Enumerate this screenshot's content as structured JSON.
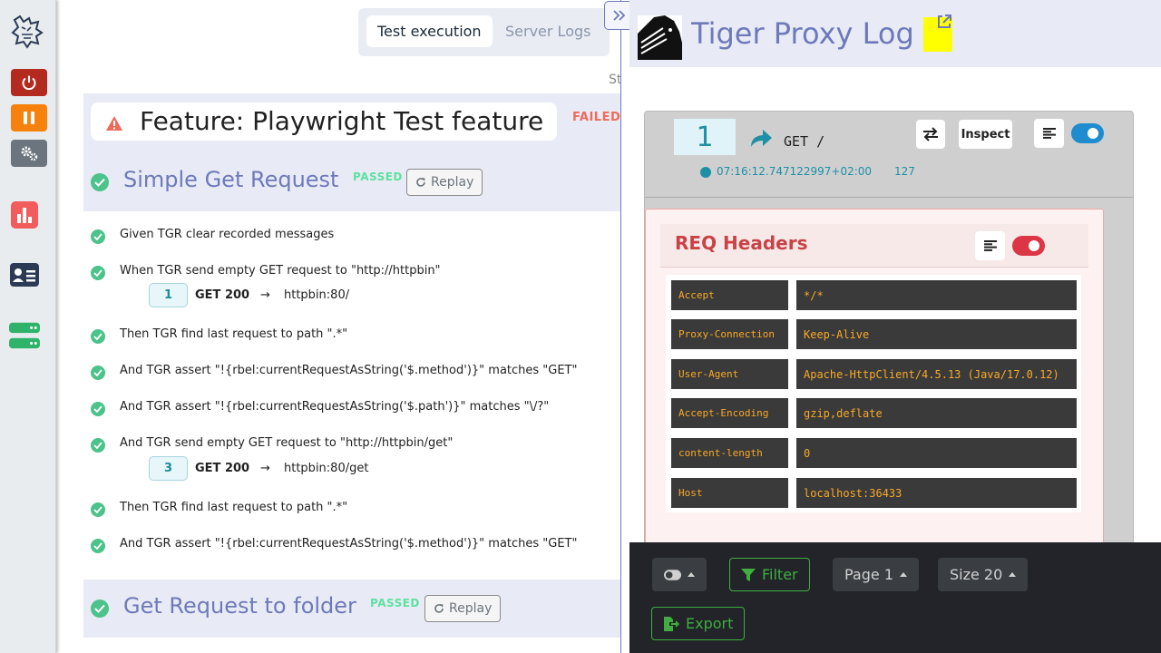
{
  "tabs": {
    "execution": "Test execution",
    "server_logs": "Server Logs"
  },
  "status_label": "St",
  "feature": {
    "title": "Feature: Playwright Test feature",
    "status": "FAILED"
  },
  "scenarios": [
    {
      "title": "Simple Get Request",
      "status": "PASSED",
      "replay": "Replay"
    },
    {
      "title": "Get Request to folder",
      "status": "PASSED",
      "replay": "Replay"
    }
  ],
  "steps": [
    {
      "text": "Given TGR clear recorded messages"
    },
    {
      "text": "When TGR send empty GET request to \"http://httpbin\""
    },
    {
      "text": "Then TGR find last request to path \".*\""
    },
    {
      "text": "And TGR assert \"!{rbel:currentRequestAsString('$.method')}\" matches \"GET\""
    },
    {
      "text": "And TGR assert \"!{rbel:currentRequestAsString('$.path')}\" matches \"\\/?\""
    },
    {
      "text": "And TGR send empty GET request to \"http://httpbin/get\""
    },
    {
      "text": "Then TGR find last request to path \".*\""
    },
    {
      "text": "And TGR assert \"!{rbel:currentRequestAsString('$.method')}\" matches \"GET\""
    }
  ],
  "messages": [
    {
      "seq": "1",
      "status": "GET 200",
      "arrow": "→",
      "target": "httpbin:80/"
    },
    {
      "seq": "3",
      "status": "GET 200",
      "arrow": "→",
      "target": "httpbin:80/get"
    }
  ],
  "proxy": {
    "title": "Tiger Proxy Log",
    "message": {
      "seq": "1",
      "method": "GET /",
      "inspect": "Inspect",
      "timestamp": "07:16:12.747122997+02:00",
      "size": "127"
    },
    "headers_title": "REQ Headers",
    "headers": [
      {
        "key": "Accept",
        "value": "*/*"
      },
      {
        "key": "Proxy-Connection",
        "value": "Keep-Alive"
      },
      {
        "key": "User-Agent",
        "value": "Apache-HttpClient/4.5.13 (Java/17.0.12)"
      },
      {
        "key": "Accept-Encoding",
        "value": "gzip,deflate"
      },
      {
        "key": "content-length",
        "value": "0"
      },
      {
        "key": "Host",
        "value": "localhost:36433"
      }
    ]
  },
  "footer": {
    "filter": "Filter",
    "page": "Page 1",
    "size": "Size 20",
    "export": "Export"
  },
  "colors": {
    "quit": "#b32a1f",
    "pause": "#f6820d",
    "settings": "#6c757d",
    "passed": "#4cc38a",
    "failed": "#ef6a5a",
    "toggle_on": "#1e8ccf",
    "toggle_red": "#dc3545"
  },
  "icons": {
    "rail": [
      "tiger-logo-icon",
      "power-icon",
      "pause-icon",
      "gears-icon",
      "chart-icon",
      "id-card-icon",
      "server-icon"
    ],
    "misc": [
      "warning-icon",
      "check-icon",
      "redo-icon",
      "chevrons-right-icon",
      "external-link-icon",
      "share-icon",
      "swap-icon",
      "align-left-icon",
      "clock-icon",
      "filter-icon",
      "export-icon"
    ]
  }
}
